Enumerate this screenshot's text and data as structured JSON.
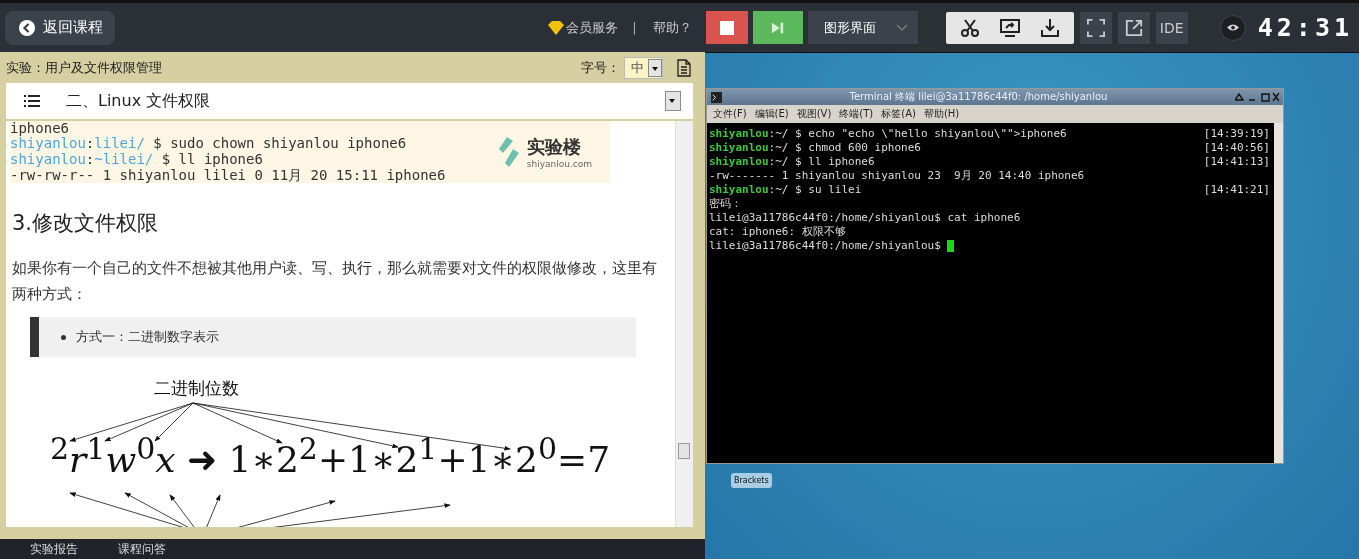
{
  "top_bar": {
    "back_button": "返回课程",
    "vip_link": "会员服务",
    "separator": "|",
    "help_link": "帮助？",
    "view_select": "图形界面",
    "ide_button": "IDE",
    "timer": "42:31"
  },
  "lab": {
    "title": "实验：用户及文件权限管理",
    "font_size_label": "字号：",
    "font_size_value": "中",
    "section_select": "二、Linux 文件权限"
  },
  "doc": {
    "code_lines": [
      {
        "kind": "output",
        "text": "iphone6"
      },
      {
        "kind": "prompt",
        "user": "shiyanlou",
        "sep": ":",
        "path": "lilei/",
        "command": " $ sudo chown shiyanlou iphone6"
      },
      {
        "kind": "prompt",
        "user": "shiyanlou",
        "sep": ":",
        "path": "~lilei/",
        "command": " $ ll iphone6"
      },
      {
        "kind": "output",
        "text": "-rw-rw-r-- 1 shiyanlou lilei 0 11月 20 15:11 iphone6"
      }
    ],
    "logo_name": "实验楼",
    "logo_url": "shiyanlou.com",
    "heading": "3.修改文件权限",
    "paragraph": "如果你有一个自己的文件不想被其他用户读、写、执行，那么就需要对文件的权限做修改，这里有两种方式：",
    "quote_items": [
      "方式一：二进制数字表示"
    ],
    "figure_title": "二进制位数",
    "formula": "$^{2}$*r*$^{1}$*w*$^{0}$*x* ➜ 1∗2$^{2}$+1∗2$^{1}$+1∗2$^{0}$=7"
  },
  "bottom_tabs": [
    "实验报告",
    "课程问答"
  ],
  "terminal": {
    "title": "Terminal 终端    lilei@3a11786c44f0: /home/shiyanlou",
    "menu": [
      "文件(F)",
      "编辑(E)",
      "视图(V)",
      "终端(T)",
      "标签(A)",
      "帮助(H)"
    ],
    "lines": [
      {
        "kind": "prompt",
        "user": "shiyanlou",
        "path": ":~/",
        "command": " $ echo \"echo \\\"hello shiyanlou\\\"\">iphone6",
        "time": "[14:39:19]"
      },
      {
        "kind": "prompt",
        "user": "shiyanlou",
        "path": ":~/",
        "command": " $ chmod 600 iphone6",
        "time": "[14:40:56]"
      },
      {
        "kind": "prompt",
        "user": "shiyanlou",
        "path": ":~/",
        "command": " $ ll iphone6",
        "time": "[14:41:13]"
      },
      {
        "kind": "output",
        "text": "-rw------- 1 shiyanlou shiyanlou 23  9月 20 14:40 iphone6"
      },
      {
        "kind": "prompt",
        "user": "shiyanlou",
        "path": ":~/",
        "command": " $ su lilei",
        "time": "[14:41:21]"
      },
      {
        "kind": "output",
        "text": "密码："
      },
      {
        "kind": "output",
        "text": "lilei@3a11786c44f0:/home/shiyanlou$ cat iphone6"
      },
      {
        "kind": "output",
        "text": "cat: iphone6: 权限不够"
      },
      {
        "kind": "cursor",
        "text": "lilei@3a11786c44f0:/home/shiyanlou$ "
      }
    ]
  },
  "desktop_icons": [
    "Brackets"
  ]
}
